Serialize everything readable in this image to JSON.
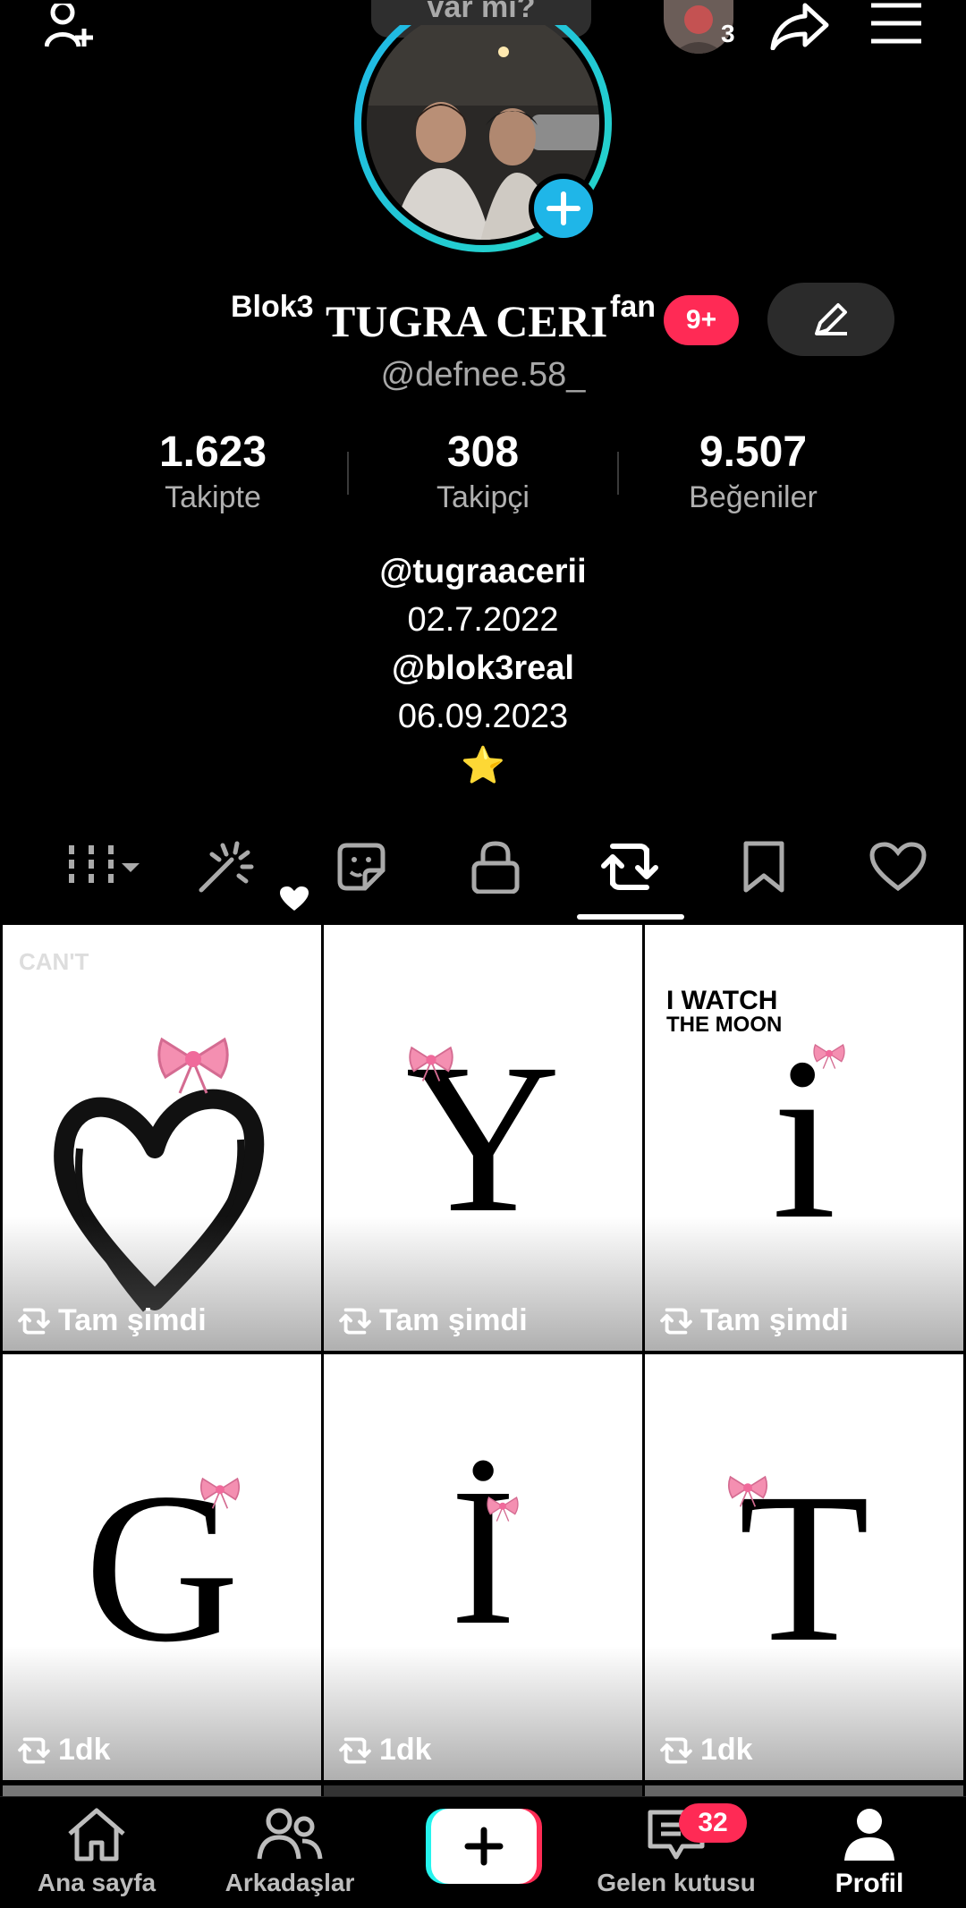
{
  "top_bar": {
    "note_text": "var mı?",
    "story_count": "3"
  },
  "profile": {
    "name_prefix": "Blok3",
    "name_main": "TUGRA CERI",
    "name_suffix": "fan",
    "notification_badge": "9+",
    "username": "@defnee.58_"
  },
  "stats": [
    {
      "value": "1.623",
      "label": "Takipte"
    },
    {
      "value": "308",
      "label": "Takipçi"
    },
    {
      "value": "9.507",
      "label": "Beğeniler"
    }
  ],
  "bio": {
    "line1": "@tugraacerii",
    "line2": "02.7.2022",
    "line3": "@blok3real",
    "line4": "06.09.2023",
    "line5": "⭐"
  },
  "tabs": [
    {
      "name": "videos-grid",
      "icon": "grid-icon"
    },
    {
      "name": "effects",
      "icon": "sparkle-icon"
    },
    {
      "name": "stickers",
      "icon": "sticker-icon"
    },
    {
      "name": "private",
      "icon": "lock-icon"
    },
    {
      "name": "reposts",
      "icon": "repost-icon",
      "active": true
    },
    {
      "name": "favorites",
      "icon": "bookmark-icon"
    },
    {
      "name": "liked",
      "icon": "heart-icon"
    }
  ],
  "videos": [
    {
      "overlay_text": "CAN'T",
      "glyph": "heart",
      "caption": "Tam şimdi"
    },
    {
      "overlay_text": "",
      "glyph": "Y",
      "caption": "Tam şimdi"
    },
    {
      "overlay_text": "I WATCH THE MOON",
      "glyph": "i",
      "caption": "Tam şimdi"
    },
    {
      "overlay_text": "",
      "glyph": "G",
      "caption": "1dk"
    },
    {
      "overlay_text": "",
      "glyph": "İ",
      "caption": "1dk"
    },
    {
      "overlay_text": "",
      "glyph": "T",
      "caption": "1dk"
    }
  ],
  "moon_line1": "I WATCH",
  "moon_line2": "THE MOON",
  "bottom_nav": {
    "home": "Ana sayfa",
    "friends": "Arkadaşlar",
    "inbox": "Gelen kutusu",
    "inbox_badge": "32",
    "profile": "Profil"
  },
  "colors": {
    "accent_blue": "#1fb6e8",
    "badge_red": "#ff2a55",
    "bow_pink": "#f48fb1"
  }
}
